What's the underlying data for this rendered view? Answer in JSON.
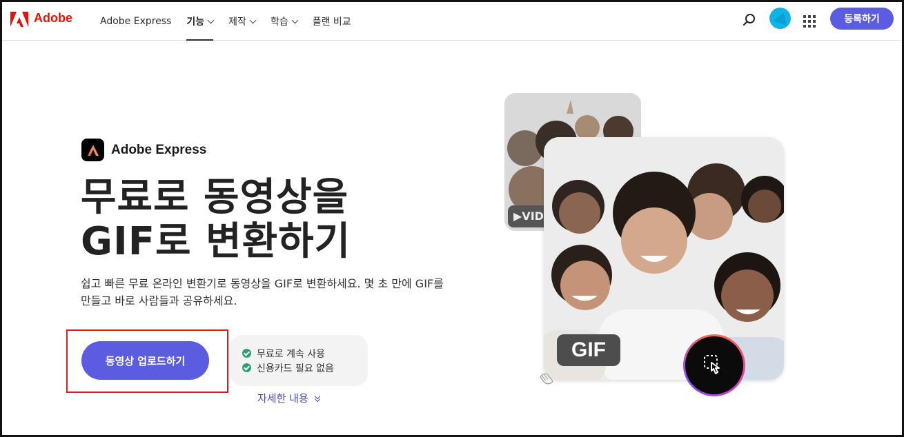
{
  "header": {
    "brand": "Adobe",
    "nav": [
      {
        "label": "Adobe Express"
      },
      {
        "label": "기능"
      },
      {
        "label": "제작"
      },
      {
        "label": "학습"
      },
      {
        "label": "플랜 비교"
      }
    ],
    "signup_label": "등록하기",
    "icons": [
      "adobe-logo-icon",
      "search-icon",
      "avatar",
      "apps-grid-icon"
    ]
  },
  "hero": {
    "product_name": "Adobe Express",
    "headline_line1": "무료로 동영상을",
    "headline_line2": "GIF로 변환하기",
    "description": "쉽고 빠른 무료 온라인 변환기로 동영상을 GIF로 변환하세요. 몇 초 만에 GIF를 만들고 바로 사람들과 공유하세요.",
    "upload_button": "동영상 업로드하기",
    "benefits": [
      "무료로 계속 사용",
      "신용카드 필요 없음"
    ],
    "more_link": "자세한 내용"
  },
  "media": {
    "video_tag": "▶VID",
    "gif_tag": "GIF"
  },
  "colors": {
    "accent": "#5c5ce0",
    "adobe_red": "#eb1000",
    "check_green": "#2d9d78",
    "highlight_border": "#e01919"
  }
}
